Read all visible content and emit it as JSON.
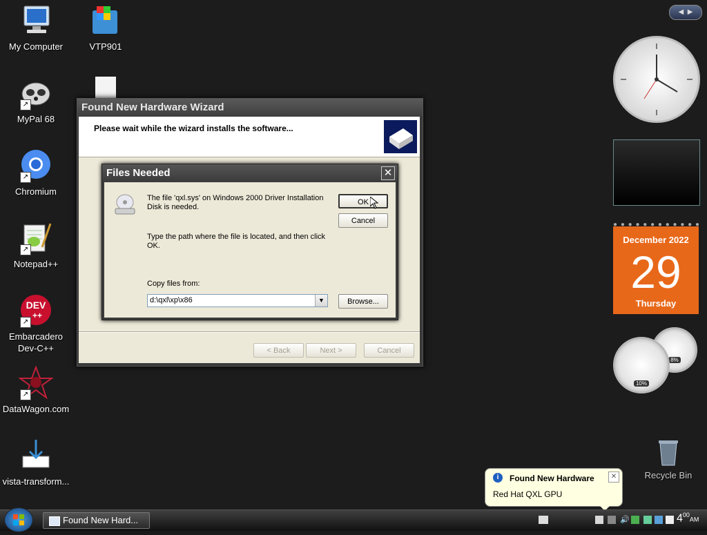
{
  "desktop": {
    "icons": [
      {
        "label": "My Computer"
      },
      {
        "label": "VTP901"
      },
      {
        "label": "MyPal 68"
      },
      {
        "label": "Chromium"
      },
      {
        "label": "Notepad++"
      },
      {
        "label": "Embarcadero Dev-C++"
      },
      {
        "label": "DataWagon.com"
      },
      {
        "label": "vista-transform..."
      },
      {
        "label": "Recycle Bin"
      }
    ]
  },
  "wizard": {
    "title": "Found New Hardware Wizard",
    "header_msg": "Please wait while the wizard installs the software...",
    "back": "< Back",
    "next": "Next >",
    "cancel": "Cancel"
  },
  "files_needed": {
    "title": "Files Needed",
    "msg1": "The file 'qxl.sys' on Windows 2000 Driver Installation Disk is needed.",
    "msg2": "Type the path where the file is located, and then click OK.",
    "copy_label": "Copy files from:",
    "path_value": "d:\\qxl\\xp\\x86",
    "ok": "OK",
    "cancel": "Cancel",
    "browse": "Browse..."
  },
  "gadgets": {
    "calendar": {
      "month": "December 2022",
      "day": "29",
      "weekday": "Thursday"
    },
    "cpu_meter": {
      "cpu": "10%",
      "memory": "8%"
    }
  },
  "balloon": {
    "title": "Found New Hardware",
    "body": "Red Hat QXL GPU"
  },
  "taskbar": {
    "task_label": "Found New Hard...",
    "time_hour": "4",
    "time_min": "00",
    "time_ampm": "AM"
  }
}
